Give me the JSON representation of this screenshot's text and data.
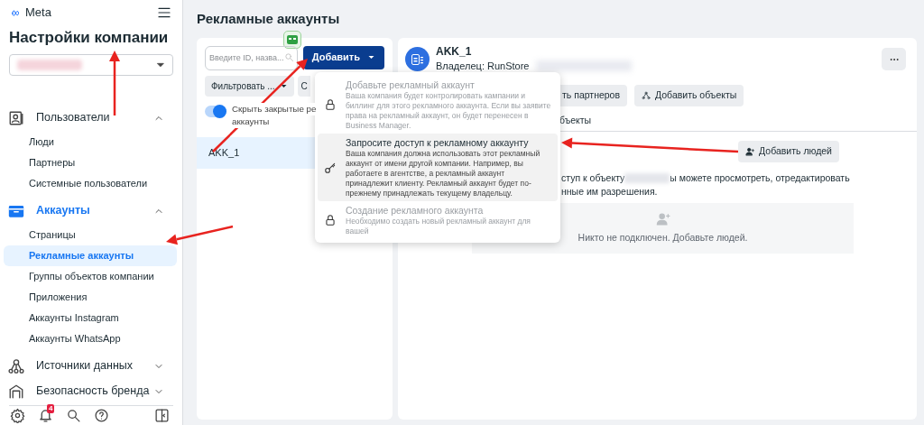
{
  "sidebar": {
    "brand": "Meta",
    "title": "Настройки компании",
    "sections": [
      {
        "kind": "users",
        "label": "Пользователи",
        "expanded": true,
        "selected": false,
        "children": [
          {
            "label": "Люди",
            "selected": false
          },
          {
            "label": "Партнеры",
            "selected": false
          },
          {
            "label": "Системные пользователи",
            "selected": false
          }
        ]
      },
      {
        "kind": "accounts",
        "label": "Аккаунты",
        "expanded": true,
        "selected": true,
        "children": [
          {
            "label": "Страницы",
            "selected": false
          },
          {
            "label": "Рекламные аккаунты",
            "selected": true
          },
          {
            "label": "Группы объектов компании",
            "selected": false
          },
          {
            "label": "Приложения",
            "selected": false
          },
          {
            "label": "Аккаунты Instagram",
            "selected": false
          },
          {
            "label": "Аккаунты WhatsApp",
            "selected": false
          }
        ]
      },
      {
        "kind": "data",
        "label": "Источники данных",
        "expanded": false,
        "selected": false
      },
      {
        "kind": "brand",
        "label": "Безопасность бренда",
        "expanded": false,
        "selected": false
      }
    ],
    "notifications_badge": "4"
  },
  "page_title": "Рекламные аккаунты",
  "list_panel": {
    "search": {
      "placeholder": "Введите ID, назва..."
    },
    "add_button": "Добавить",
    "filter_button": "Фильтровать ...",
    "second_filter_fragment": "С",
    "hide_closed": {
      "label_lines": [
        "Скрыть закрытые ре",
        "аккаунты"
      ],
      "on": true
    },
    "accounts": [
      {
        "name": "AKK_1",
        "selected": true
      }
    ]
  },
  "add_menu": {
    "items": [
      {
        "kind": "lock",
        "title": "Добавьте рекламный аккаунт",
        "description": "Ваша компания будет контролировать кампании и биллинг для этого рекламного аккаунта. Если вы заявите права на рекламный аккаунт, он будет перенесен в Business Manager.",
        "disabled": true,
        "highlighted": false
      },
      {
        "kind": "key",
        "title": "Запросите доступ к рекламному аккаунту",
        "description": "Ваша компания должна использовать этот рекламный аккаунт от имени другой компании. Например, вы работаете в агентстве, а рекламный аккаунт принадлежит клиенту. Рекламный аккаунт будет по-прежнему принадлежать текущему владельцу.",
        "disabled": false,
        "highlighted": true
      },
      {
        "kind": "lock",
        "title": "Создание рекламного аккаунта",
        "description": "Необходимо создать новый рекламный аккаунт для вашей",
        "disabled": true,
        "highlighted": false
      }
    ]
  },
  "detail": {
    "name": "AKK_1",
    "owner": "Владелец: RunStore",
    "action_buttons": [
      "ть партнеров",
      "Добавить объекты"
    ],
    "tab_fragment": "бъекты",
    "add_people_button": "Добавить людей",
    "text_lines": [
      [
        "ступ к объекту",
        "ы можете просмотреть, отредактировать"
      ],
      [
        "нные им разрешения."
      ]
    ],
    "empty_state": "Никто не подключен. Добавьте людей."
  }
}
